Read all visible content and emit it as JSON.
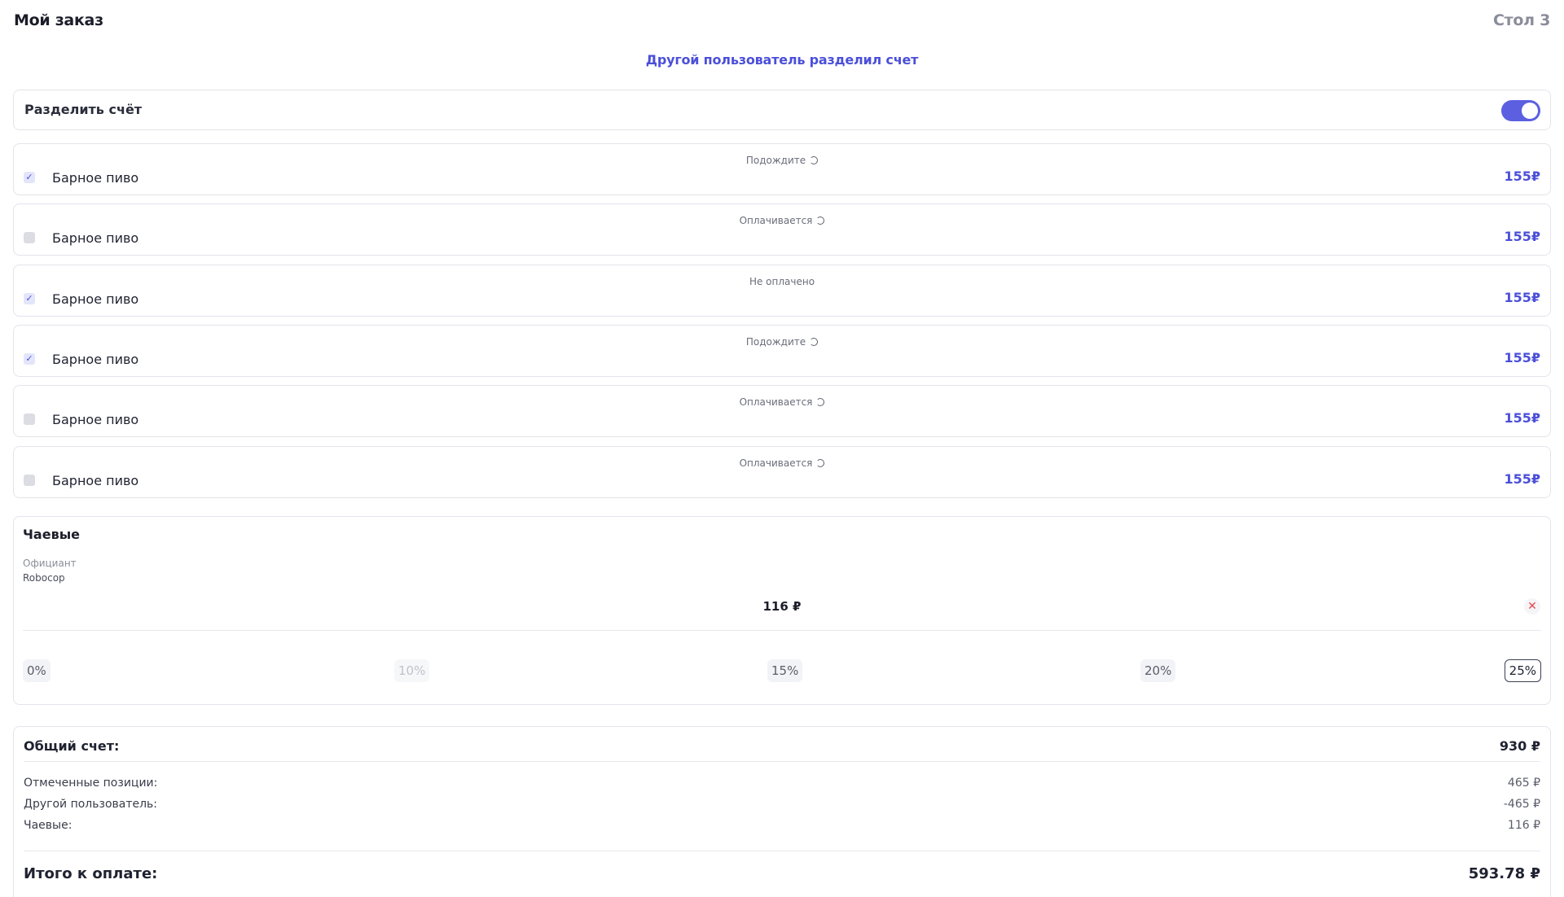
{
  "header": {
    "title": "Мой заказ",
    "table": "Стол 3"
  },
  "notice": "Другой пользователь разделил счет",
  "split": {
    "label": "Разделить счёт",
    "enabled": true
  },
  "items": [
    {
      "status": "Подождите",
      "name": "Барное пиво",
      "price": "155₽",
      "checked": true,
      "loading": true
    },
    {
      "status": "Оплачивается",
      "name": "Барное пиво",
      "price": "155₽",
      "checked": false,
      "loading": true
    },
    {
      "status": "Не оплачено",
      "name": "Барное пиво",
      "price": "155₽",
      "checked": true,
      "loading": false
    },
    {
      "status": "Подождите",
      "name": "Барное пиво",
      "price": "155₽",
      "checked": true,
      "loading": true
    },
    {
      "status": "Оплачивается",
      "name": "Барное пиво",
      "price": "155₽",
      "checked": false,
      "loading": true
    },
    {
      "status": "Оплачивается",
      "name": "Барное пиво",
      "price": "155₽",
      "checked": false,
      "loading": true
    }
  ],
  "tips": {
    "title": "Чаевые",
    "waiter_label": "Официант",
    "waiter_name": "Robocop",
    "amount": "116 ₽",
    "options": [
      "0%",
      "10%",
      "15%",
      "20%",
      "25%"
    ],
    "selected": "25%",
    "disabled": [
      "10%"
    ]
  },
  "summary": {
    "total_label": "Общий счет:",
    "total_value": "930 ₽",
    "selected_label": "Отмеченные позиции:",
    "selected_value": "465 ₽",
    "other_label": "Другой пользователь:",
    "other_value": "-465 ₽",
    "tips_label": "Чаевые:",
    "tips_value": "116 ₽",
    "grand_label": "Итого к оплате:",
    "grand_value": "593.78 ₽"
  },
  "colors": {
    "accent": "#4b4fd8",
    "toggle": "#5b5fe0",
    "danger": "#e5484d"
  }
}
